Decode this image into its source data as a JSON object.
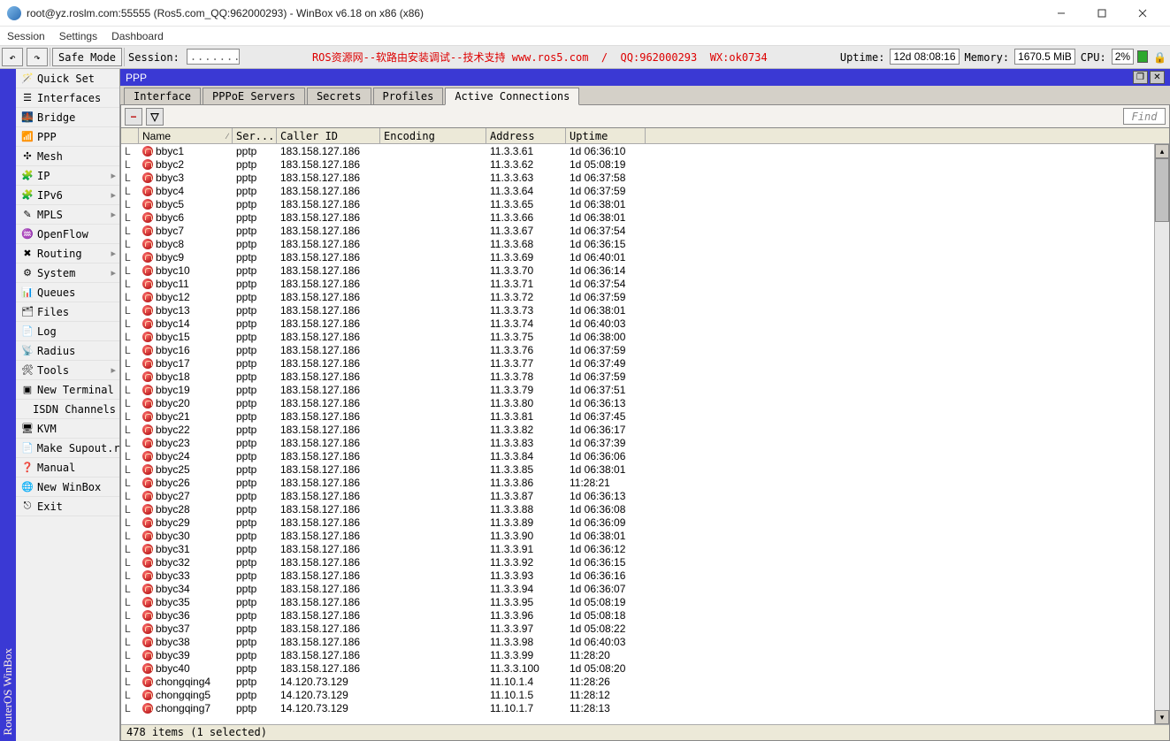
{
  "window": {
    "title": "root@yz.roslm.com:55555 (Ros5.com_QQ:962000293) - WinBox v6.18 on x86 (x86)"
  },
  "menu": {
    "session": "Session",
    "settings": "Settings",
    "dashboard": "Dashboard"
  },
  "sessionbar": {
    "safe_mode": "Safe Mode",
    "session_label": "Session:",
    "session_value": ".......",
    "center_msg": "ROS资源网--软路由安装调试--技术支持 www.ros5.com  /  QQ:962000293  WX:ok0734",
    "uptime_label": "Uptime:",
    "uptime_value": "12d 08:08:16",
    "memory_label": "Memory:",
    "memory_value": "1670.5 MiB",
    "cpu_label": "CPU:",
    "cpu_value": "2%"
  },
  "rail": "RouterOS WinBox",
  "sidebar": [
    {
      "icon": "wand",
      "label": "Quick Set",
      "sub": ""
    },
    {
      "icon": "bars",
      "label": "Interfaces",
      "sub": ""
    },
    {
      "icon": "bridge",
      "label": "Bridge",
      "sub": ""
    },
    {
      "icon": "ppp",
      "label": "PPP",
      "sub": ""
    },
    {
      "icon": "mesh",
      "label": "Mesh",
      "sub": ""
    },
    {
      "icon": "ip",
      "label": "IP",
      "sub": "▸"
    },
    {
      "icon": "ipv6",
      "label": "IPv6",
      "sub": "▸"
    },
    {
      "icon": "mpls",
      "label": "MPLS",
      "sub": "▸"
    },
    {
      "icon": "flow",
      "label": "OpenFlow",
      "sub": ""
    },
    {
      "icon": "route",
      "label": "Routing",
      "sub": "▸"
    },
    {
      "icon": "sys",
      "label": "System",
      "sub": "▸"
    },
    {
      "icon": "queue",
      "label": "Queues",
      "sub": ""
    },
    {
      "icon": "files",
      "label": "Files",
      "sub": ""
    },
    {
      "icon": "log",
      "label": "Log",
      "sub": ""
    },
    {
      "icon": "radius",
      "label": "Radius",
      "sub": ""
    },
    {
      "icon": "tools",
      "label": "Tools",
      "sub": "▸"
    },
    {
      "icon": "term",
      "label": "New Terminal",
      "sub": ""
    },
    {
      "icon": "",
      "label": "ISDN Channels",
      "sub": ""
    },
    {
      "icon": "kvm",
      "label": "KVM",
      "sub": ""
    },
    {
      "icon": "sup",
      "label": "Make Supout.rif",
      "sub": ""
    },
    {
      "icon": "help",
      "label": "Manual",
      "sub": ""
    },
    {
      "icon": "win",
      "label": "New WinBox",
      "sub": ""
    },
    {
      "icon": "exit",
      "label": "Exit",
      "sub": ""
    }
  ],
  "panel_title": "PPP",
  "tabs": {
    "interface": "Interface",
    "pppoe": "PPPoE Servers",
    "secrets": "Secrets",
    "profiles": "Profiles",
    "active": "Active Connections"
  },
  "toolbar": {
    "remove": "−",
    "filter": "▽",
    "find": "Find"
  },
  "columns": {
    "name": "Name",
    "service": "Ser...",
    "caller": "Caller ID",
    "encoding": "Encoding",
    "address": "Address",
    "uptime": "Uptime"
  },
  "rows": [
    {
      "f": "L",
      "n": "bbyc1",
      "s": "pptp",
      "c": "183.158.127.186",
      "a": "11.3.3.61",
      "u": "1d 06:36:10"
    },
    {
      "f": "L",
      "n": "bbyc2",
      "s": "pptp",
      "c": "183.158.127.186",
      "a": "11.3.3.62",
      "u": "1d 05:08:19"
    },
    {
      "f": "L",
      "n": "bbyc3",
      "s": "pptp",
      "c": "183.158.127.186",
      "a": "11.3.3.63",
      "u": "1d 06:37:58"
    },
    {
      "f": "L",
      "n": "bbyc4",
      "s": "pptp",
      "c": "183.158.127.186",
      "a": "11.3.3.64",
      "u": "1d 06:37:59"
    },
    {
      "f": "L",
      "n": "bbyc5",
      "s": "pptp",
      "c": "183.158.127.186",
      "a": "11.3.3.65",
      "u": "1d 06:38:01"
    },
    {
      "f": "L",
      "n": "bbyc6",
      "s": "pptp",
      "c": "183.158.127.186",
      "a": "11.3.3.66",
      "u": "1d 06:38:01"
    },
    {
      "f": "L",
      "n": "bbyc7",
      "s": "pptp",
      "c": "183.158.127.186",
      "a": "11.3.3.67",
      "u": "1d 06:37:54"
    },
    {
      "f": "L",
      "n": "bbyc8",
      "s": "pptp",
      "c": "183.158.127.186",
      "a": "11.3.3.68",
      "u": "1d 06:36:15"
    },
    {
      "f": "L",
      "n": "bbyc9",
      "s": "pptp",
      "c": "183.158.127.186",
      "a": "11.3.3.69",
      "u": "1d 06:40:01"
    },
    {
      "f": "L",
      "n": "bbyc10",
      "s": "pptp",
      "c": "183.158.127.186",
      "a": "11.3.3.70",
      "u": "1d 06:36:14"
    },
    {
      "f": "L",
      "n": "bbyc11",
      "s": "pptp",
      "c": "183.158.127.186",
      "a": "11.3.3.71",
      "u": "1d 06:37:54"
    },
    {
      "f": "L",
      "n": "bbyc12",
      "s": "pptp",
      "c": "183.158.127.186",
      "a": "11.3.3.72",
      "u": "1d 06:37:59"
    },
    {
      "f": "L",
      "n": "bbyc13",
      "s": "pptp",
      "c": "183.158.127.186",
      "a": "11.3.3.73",
      "u": "1d 06:38:01"
    },
    {
      "f": "L",
      "n": "bbyc14",
      "s": "pptp",
      "c": "183.158.127.186",
      "a": "11.3.3.74",
      "u": "1d 06:40:03"
    },
    {
      "f": "L",
      "n": "bbyc15",
      "s": "pptp",
      "c": "183.158.127.186",
      "a": "11.3.3.75",
      "u": "1d 06:38:00"
    },
    {
      "f": "L",
      "n": "bbyc16",
      "s": "pptp",
      "c": "183.158.127.186",
      "a": "11.3.3.76",
      "u": "1d 06:37:59"
    },
    {
      "f": "L",
      "n": "bbyc17",
      "s": "pptp",
      "c": "183.158.127.186",
      "a": "11.3.3.77",
      "u": "1d 06:37:49"
    },
    {
      "f": "L",
      "n": "bbyc18",
      "s": "pptp",
      "c": "183.158.127.186",
      "a": "11.3.3.78",
      "u": "1d 06:37:59"
    },
    {
      "f": "L",
      "n": "bbyc19",
      "s": "pptp",
      "c": "183.158.127.186",
      "a": "11.3.3.79",
      "u": "1d 06:37:51"
    },
    {
      "f": "L",
      "n": "bbyc20",
      "s": "pptp",
      "c": "183.158.127.186",
      "a": "11.3.3.80",
      "u": "1d 06:36:13"
    },
    {
      "f": "L",
      "n": "bbyc21",
      "s": "pptp",
      "c": "183.158.127.186",
      "a": "11.3.3.81",
      "u": "1d 06:37:45"
    },
    {
      "f": "L",
      "n": "bbyc22",
      "s": "pptp",
      "c": "183.158.127.186",
      "a": "11.3.3.82",
      "u": "1d 06:36:17"
    },
    {
      "f": "L",
      "n": "bbyc23",
      "s": "pptp",
      "c": "183.158.127.186",
      "a": "11.3.3.83",
      "u": "1d 06:37:39"
    },
    {
      "f": "L",
      "n": "bbyc24",
      "s": "pptp",
      "c": "183.158.127.186",
      "a": "11.3.3.84",
      "u": "1d 06:36:06"
    },
    {
      "f": "L",
      "n": "bbyc25",
      "s": "pptp",
      "c": "183.158.127.186",
      "a": "11.3.3.85",
      "u": "1d 06:38:01"
    },
    {
      "f": "L",
      "n": "bbyc26",
      "s": "pptp",
      "c": "183.158.127.186",
      "a": "11.3.3.86",
      "u": "11:28:21"
    },
    {
      "f": "L",
      "n": "bbyc27",
      "s": "pptp",
      "c": "183.158.127.186",
      "a": "11.3.3.87",
      "u": "1d 06:36:13"
    },
    {
      "f": "L",
      "n": "bbyc28",
      "s": "pptp",
      "c": "183.158.127.186",
      "a": "11.3.3.88",
      "u": "1d 06:36:08"
    },
    {
      "f": "L",
      "n": "bbyc29",
      "s": "pptp",
      "c": "183.158.127.186",
      "a": "11.3.3.89",
      "u": "1d 06:36:09"
    },
    {
      "f": "L",
      "n": "bbyc30",
      "s": "pptp",
      "c": "183.158.127.186",
      "a": "11.3.3.90",
      "u": "1d 06:38:01"
    },
    {
      "f": "L",
      "n": "bbyc31",
      "s": "pptp",
      "c": "183.158.127.186",
      "a": "11.3.3.91",
      "u": "1d 06:36:12"
    },
    {
      "f": "L",
      "n": "bbyc32",
      "s": "pptp",
      "c": "183.158.127.186",
      "a": "11.3.3.92",
      "u": "1d 06:36:15"
    },
    {
      "f": "L",
      "n": "bbyc33",
      "s": "pptp",
      "c": "183.158.127.186",
      "a": "11.3.3.93",
      "u": "1d 06:36:16"
    },
    {
      "f": "L",
      "n": "bbyc34",
      "s": "pptp",
      "c": "183.158.127.186",
      "a": "11.3.3.94",
      "u": "1d 06:36:07"
    },
    {
      "f": "L",
      "n": "bbyc35",
      "s": "pptp",
      "c": "183.158.127.186",
      "a": "11.3.3.95",
      "u": "1d 05:08:19"
    },
    {
      "f": "L",
      "n": "bbyc36",
      "s": "pptp",
      "c": "183.158.127.186",
      "a": "11.3.3.96",
      "u": "1d 05:08:18"
    },
    {
      "f": "L",
      "n": "bbyc37",
      "s": "pptp",
      "c": "183.158.127.186",
      "a": "11.3.3.97",
      "u": "1d 05:08:22"
    },
    {
      "f": "L",
      "n": "bbyc38",
      "s": "pptp",
      "c": "183.158.127.186",
      "a": "11.3.3.98",
      "u": "1d 06:40:03"
    },
    {
      "f": "L",
      "n": "bbyc39",
      "s": "pptp",
      "c": "183.158.127.186",
      "a": "11.3.3.99",
      "u": "11:28:20"
    },
    {
      "f": "L",
      "n": "bbyc40",
      "s": "pptp",
      "c": "183.158.127.186",
      "a": "11.3.3.100",
      "u": "1d 05:08:20"
    },
    {
      "f": "L",
      "n": "chongqing4",
      "s": "pptp",
      "c": "14.120.73.129",
      "a": "11.10.1.4",
      "u": "11:28:26"
    },
    {
      "f": "L",
      "n": "chongqing5",
      "s": "pptp",
      "c": "14.120.73.129",
      "a": "11.10.1.5",
      "u": "11:28:12"
    },
    {
      "f": "L",
      "n": "chongqing7",
      "s": "pptp",
      "c": "14.120.73.129",
      "a": "11.10.1.7",
      "u": "11:28:13"
    }
  ],
  "status_line": "478 items (1 selected)",
  "icons": {
    "wand": "🪄",
    "bars": "☰",
    "bridge": "🌉",
    "ppp": "📶",
    "mesh": "✣",
    "ip": "🧩",
    "ipv6": "🧩",
    "mpls": "✎",
    "flow": "♒",
    "route": "✖",
    "sys": "⚙",
    "queue": "📊",
    "files": "🗂",
    "log": "📄",
    "radius": "📡",
    "tools": "🛠",
    "term": "▣",
    "kvm": "🖥",
    "sup": "📄",
    "help": "❓",
    "win": "🌐",
    "exit": "⎋"
  }
}
